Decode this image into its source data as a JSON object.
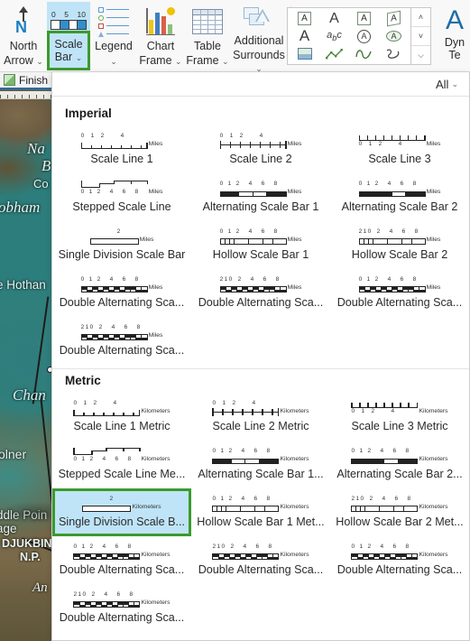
{
  "ribbon": {
    "items": [
      {
        "label_line1": "North",
        "label_line2": "Arrow",
        "icon": "north-arrow-icon",
        "has_caret": true
      },
      {
        "label_line1": "Legend",
        "label_line2": "",
        "icon": "legend-icon",
        "has_caret": true
      },
      {
        "label_line1": "Chart",
        "label_line2": "Frame",
        "icon": "chart-frame-icon",
        "has_caret": true
      },
      {
        "label_line1": "Table",
        "label_line2": "Frame",
        "icon": "table-frame-icon",
        "has_caret": true
      },
      {
        "label_line1": "Additional",
        "label_line2": "Surrounds",
        "icon": "additional-surrounds-icon",
        "has_caret": true
      }
    ],
    "scale_bar_button": {
      "label_line1": "Scale",
      "label_line2": "Bar",
      "icon": "scale-bar-icon",
      "icon_numbers": [
        "0",
        "5",
        "10"
      ],
      "active": true,
      "highlight_color": "#bfe4f7",
      "selection_border_color": "#3c9a2e"
    },
    "dynamic_text": {
      "label_line1": "Dyn",
      "label_line2": "Te",
      "glyph": "A"
    },
    "text_gallery": {
      "icons": [
        "text-boxed-icon",
        "text-plain-icon",
        "text-boxed-2-icon",
        "text-tilted-boxed-icon",
        "text-large-icon",
        "text-curved-abc-icon",
        "text-circle-icon",
        "text-ellipse-icon",
        "picture-icon",
        "polyline-icon",
        "curve-icon",
        "spiral-icon"
      ],
      "scroll_up": "˄",
      "scroll_down": "˅",
      "scroll_more": "⌵"
    }
  },
  "finish_bar": {
    "label": "Finish",
    "icon": "finish-edit-icon"
  },
  "map": {
    "labels": [
      {
        "text": "Na",
        "style": "italic"
      },
      {
        "text": "B",
        "style": "italic"
      },
      {
        "text": "Co",
        "style": "plain"
      },
      {
        "text": "obham",
        "style": "italic"
      },
      {
        "text": "e Hothan",
        "style": "plain"
      },
      {
        "text": "Chan",
        "style": "italic"
      },
      {
        "text": "olner",
        "style": "plain"
      },
      {
        "text": "ddle Poin",
        "style": "plain"
      },
      {
        "text": "age",
        "style": "plain"
      },
      {
        "text": "DJUKBIN",
        "style": "plain"
      },
      {
        "text": "N.P.",
        "style": "plain"
      },
      {
        "text": "An",
        "style": "italic"
      }
    ]
  },
  "gallery": {
    "filter_label": "All",
    "sections": [
      {
        "title": "Imperial",
        "unit": "Miles",
        "items": [
          {
            "label": "Scale Line 1",
            "preview": "scale-line-1",
            "numbers": [
              "0",
              "1",
              "2",
              "4"
            ]
          },
          {
            "label": "Scale Line 2",
            "preview": "scale-line-2",
            "numbers": [
              "0",
              "1",
              "2",
              "4"
            ]
          },
          {
            "label": "Scale Line 3",
            "preview": "scale-line-3",
            "numbers": [
              "0",
              "1",
              "2",
              "4"
            ]
          },
          {
            "label": "Stepped Scale Line",
            "preview": "stepped-scale-line",
            "numbers": [
              "0",
              "1",
              "2",
              "4",
              "6",
              "8"
            ]
          },
          {
            "label": "Alternating Scale Bar 1",
            "preview": "alternating-bar-1",
            "numbers": [
              "0",
              "1",
              "2",
              "4",
              "6",
              "8"
            ]
          },
          {
            "label": "Alternating Scale Bar 2",
            "preview": "alternating-bar-2",
            "numbers": [
              "0",
              "1",
              "2",
              "4",
              "6",
              "8"
            ]
          },
          {
            "label": "Single Division Scale Bar",
            "preview": "single-division",
            "numbers": [
              "2"
            ]
          },
          {
            "label": "Hollow Scale Bar 1",
            "preview": "hollow-bar-1",
            "numbers": [
              "0",
              "1",
              "2",
              "4",
              "6",
              "8"
            ]
          },
          {
            "label": "Hollow Scale Bar 2",
            "preview": "hollow-bar-2",
            "numbers": [
              "2",
              "1",
              "0",
              "2",
              "4",
              "6",
              "8"
            ]
          },
          {
            "label": "Double Alternating Sca...",
            "preview": "double-alternating-1",
            "numbers": [
              "0",
              "1",
              "2",
              "4",
              "6",
              "8"
            ]
          },
          {
            "label": "Double Alternating Sca...",
            "preview": "double-alternating-2",
            "numbers": [
              "2",
              "1",
              "0",
              "2",
              "4",
              "6",
              "8"
            ]
          },
          {
            "label": "Double Alternating Sca...",
            "preview": "double-alternating-3",
            "numbers": [
              "0",
              "1",
              "2",
              "4",
              "6",
              "8"
            ]
          },
          {
            "label": "Double Alternating Sca...",
            "preview": "double-alternating-4",
            "numbers": [
              "2",
              "1",
              "0",
              "2",
              "4",
              "6",
              "8"
            ]
          }
        ]
      },
      {
        "title": "Metric",
        "unit": "Kilometers",
        "items": [
          {
            "label": "Scale Line 1 Metric",
            "preview": "scale-line-1",
            "numbers": [
              "0",
              "1",
              "2",
              "4"
            ]
          },
          {
            "label": "Scale Line 2 Metric",
            "preview": "scale-line-2",
            "numbers": [
              "0",
              "1",
              "2",
              "4"
            ]
          },
          {
            "label": "Scale Line 3 Metric",
            "preview": "scale-line-3",
            "numbers": [
              "0",
              "1",
              "2",
              "4"
            ]
          },
          {
            "label": "Stepped Scale Line Me...",
            "preview": "stepped-scale-line",
            "numbers": [
              "0",
              "1",
              "2",
              "4",
              "6",
              "8"
            ]
          },
          {
            "label": "Alternating Scale Bar 1...",
            "preview": "alternating-bar-1",
            "numbers": [
              "0",
              "1",
              "2",
              "4",
              "6",
              "8"
            ]
          },
          {
            "label": "Alternating Scale Bar 2...",
            "preview": "alternating-bar-2",
            "numbers": [
              "0",
              "1",
              "2",
              "4",
              "6",
              "8"
            ]
          },
          {
            "label": "Single Division Scale B...",
            "preview": "single-division",
            "numbers": [
              "2"
            ],
            "selected": true
          },
          {
            "label": "Hollow Scale Bar 1 Met...",
            "preview": "hollow-bar-1",
            "numbers": [
              "0",
              "1",
              "2",
              "4",
              "6",
              "8"
            ]
          },
          {
            "label": "Hollow Scale Bar 2 Met...",
            "preview": "hollow-bar-2",
            "numbers": [
              "2",
              "1",
              "0",
              "2",
              "4",
              "6",
              "8"
            ]
          },
          {
            "label": "Double Alternating Sca...",
            "preview": "double-alternating-1",
            "numbers": [
              "0",
              "1",
              "2",
              "4",
              "6",
              "8"
            ]
          },
          {
            "label": "Double Alternating Sca...",
            "preview": "double-alternating-2",
            "numbers": [
              "2",
              "1",
              "0",
              "2",
              "4",
              "6",
              "8"
            ]
          },
          {
            "label": "Double Alternating Sca...",
            "preview": "double-alternating-3",
            "numbers": [
              "0",
              "1",
              "2",
              "4",
              "6",
              "8"
            ]
          },
          {
            "label": "Double Alternating Sca...",
            "preview": "double-alternating-4",
            "numbers": [
              "2",
              "1",
              "0",
              "2",
              "4",
              "6",
              "8"
            ]
          }
        ]
      }
    ]
  }
}
